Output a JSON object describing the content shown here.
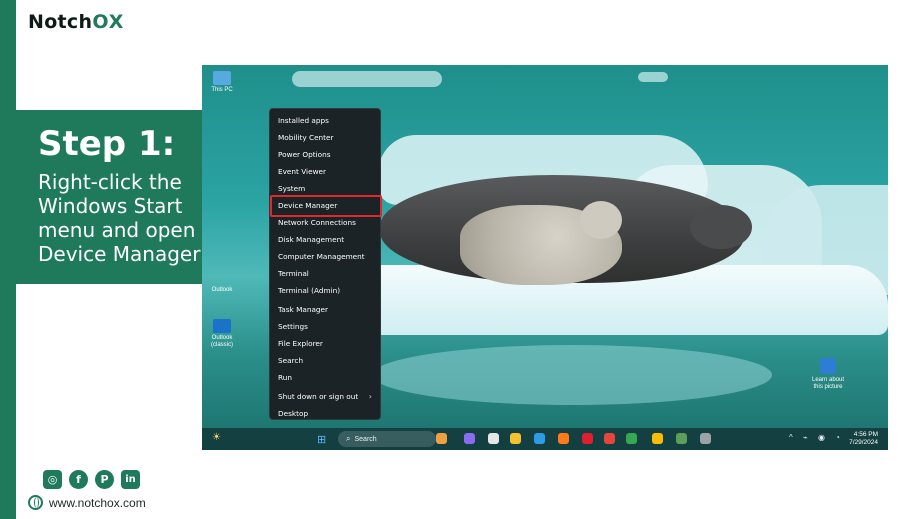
{
  "brand": {
    "text_main": "Notch",
    "text_accent": "ОX"
  },
  "step": {
    "title": "Step 1:",
    "line1": "Right-click the",
    "line2": "Windows Start",
    "line3": "menu and open",
    "line4": "Device Manager"
  },
  "desktop": {
    "icons": [
      {
        "label": "This PC"
      },
      {
        "label": "Outlook"
      },
      {
        "label": "Outlook (classic)"
      }
    ],
    "widget_label_1": "Learn about",
    "widget_label_2": "this picture"
  },
  "menu": {
    "items": [
      "Installed apps",
      "Mobility Center",
      "Power Options",
      "Event Viewer",
      "System",
      "Device Manager",
      "Network Connections",
      "Disk Management",
      "Computer Management",
      "Terminal",
      "Terminal (Admin)",
      "Task Manager",
      "Settings",
      "File Explorer",
      "Search",
      "Run",
      "Shut down or sign out",
      "Desktop"
    ],
    "highlighted": "Device Manager",
    "submenu_chevron": "›"
  },
  "taskbar": {
    "search_placeholder": "Search",
    "time": "4:56 PM",
    "date": "7/29/2024"
  },
  "footer": {
    "website": "www.notchox.com",
    "socials": [
      "instagram",
      "facebook",
      "pinterest",
      "linkedin"
    ]
  },
  "colors": {
    "brand_green": "#1f7a5c",
    "highlight_red": "#e0282e",
    "menu_bg": "#1c2326"
  }
}
